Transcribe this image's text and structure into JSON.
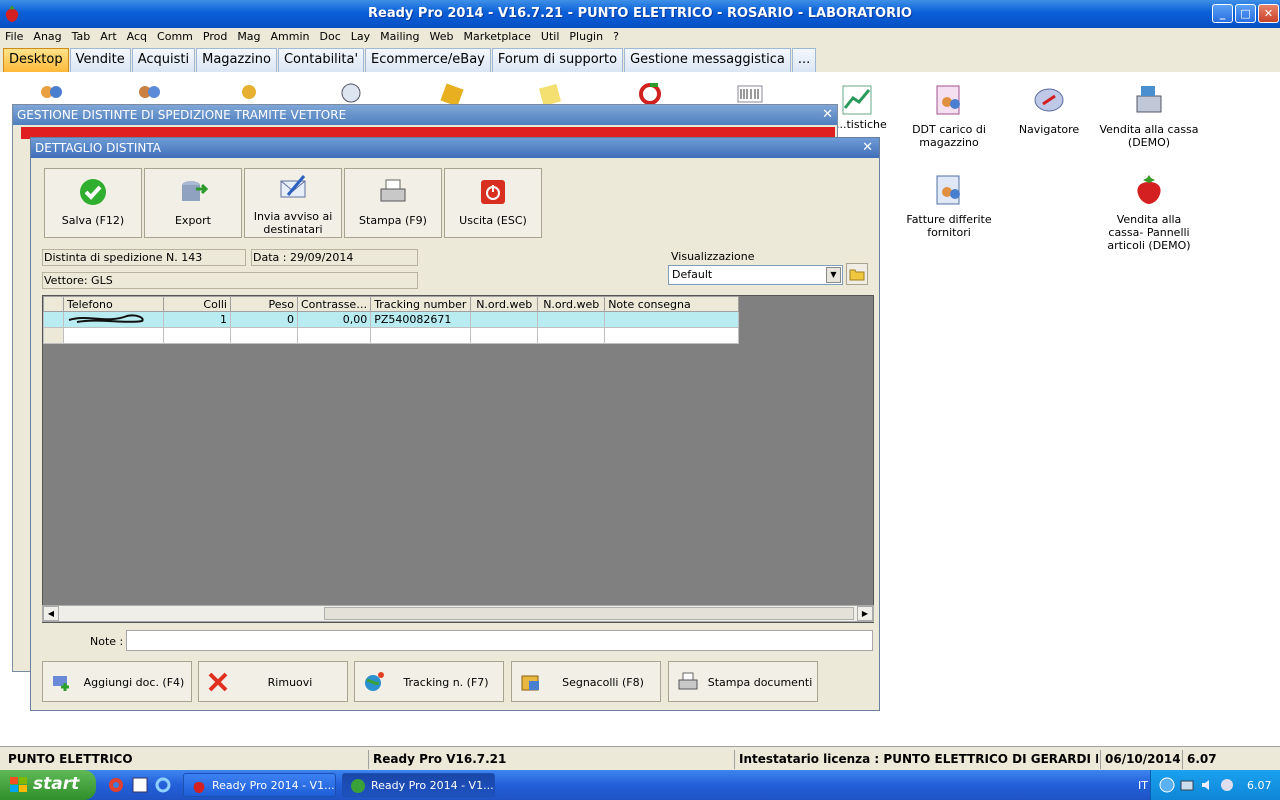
{
  "window": {
    "title": "Ready Pro 2014 - V16.7.21 - PUNTO ELETTRICO - ROSARIO - LABORATORIO",
    "controls": [
      "_",
      "□",
      "✕"
    ]
  },
  "menu": [
    "File",
    "Anag",
    "Tab",
    "Art",
    "Acq",
    "Comm",
    "Prod",
    "Mag",
    "Ammin",
    "Doc",
    "Lay",
    "Mailing",
    "Web",
    "Marketplace",
    "Util",
    "Plugin",
    "?"
  ],
  "tabs": [
    "Desktop",
    "Vendite",
    "Acquisti",
    "Magazzino",
    "Contabilita'",
    "Ecommerce/eBay",
    "Forum di supporto",
    "Gestione messaggistica",
    "..."
  ],
  "active_tab": "Desktop",
  "desktop_icons": [
    {
      "label": "...tistiche"
    },
    {
      "label": "DDT carico di magazzino"
    },
    {
      "label": "Navigatore"
    },
    {
      "label": "Vendita alla cassa (DEMO)"
    },
    {
      "label": "Fatture differite fornitori"
    },
    {
      "label": "Vendita alla cassa- Pannelli articoli (DEMO)"
    }
  ],
  "background_window": {
    "title": "GESTIONE DISTINTE DI SPEDIZIONE TRAMITE VETTORE"
  },
  "dialog": {
    "title": "DETTAGLIO DISTINTA",
    "toolbar": {
      "save": "Salva (F12)",
      "export": "Export",
      "send_line1": "Invia avviso ai",
      "send_line2": "destinatari",
      "print": "Stampa (F9)",
      "exit": "Uscita (ESC)"
    },
    "distinta_number": "Distinta di spedizione N. 143",
    "date": "Data : 29/09/2014",
    "carrier": "Vettore: GLS",
    "view_label": "Visualizzazione",
    "view_value": "Default",
    "grid": {
      "columns": [
        "Telefono",
        "Colli",
        "Peso",
        "Contrasse…",
        "Tracking number",
        "N.ord.web",
        "N.ord.web",
        "Note consegna"
      ],
      "rows": [
        {
          "telefono": "",
          "colli": "1",
          "peso": "0",
          "contrassegno": "0,00",
          "tracking": "PZ540082671",
          "ord1": "",
          "ord2": "",
          "note": ""
        }
      ]
    },
    "note_label": "Note :",
    "bottom_buttons": {
      "add": "Aggiungi doc. (F4)",
      "remove": "Rimuovi",
      "tracking": "Tracking n. (F7)",
      "labels": "Segnacolli (F8)",
      "print_docs": "Stampa documenti"
    }
  },
  "statusbar": {
    "company": "PUNTO ELETTRICO",
    "version": "Ready Pro V16.7.21",
    "license": "Intestatario licenza : PUNTO ELETTRICO DI GERARDI MARTA",
    "date": "06/10/2014",
    "time": "6.07"
  },
  "taskbar": {
    "start": "start",
    "task1": "Ready Pro 2014 - V1...",
    "task2": "Ready Pro 2014 - V1...",
    "lang": "IT",
    "clock": "6.07"
  }
}
